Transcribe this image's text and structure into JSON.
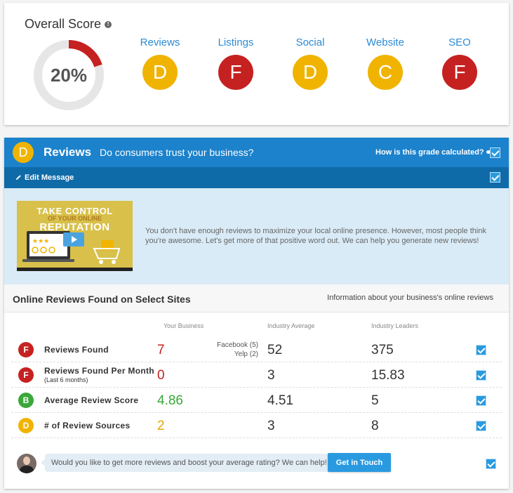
{
  "overall": {
    "title": "Overall Score",
    "score_label": "20%",
    "score_fraction": 0.2,
    "colors": {
      "arc": "#c62121",
      "track": "#e6e6e6"
    }
  },
  "categories": [
    {
      "label": "Reviews",
      "grade": "D"
    },
    {
      "label": "Listings",
      "grade": "F"
    },
    {
      "label": "Social",
      "grade": "D"
    },
    {
      "label": "Website",
      "grade": "C"
    },
    {
      "label": "SEO",
      "grade": "F"
    }
  ],
  "reviews_section": {
    "grade": "D",
    "title": "Reviews",
    "subtitle": "Do consumers trust your business?",
    "how_label": "How is this grade calculated?",
    "edit_label": "Edit Message",
    "promo": {
      "line1": "TAKE CONTROL",
      "line2": "OF YOUR ONLINE",
      "line3": "REPUTATION"
    },
    "message": "You don't have enough reviews to maximize your local online presence. However, most people think you're awesome. Let's get more of that positive word out. We can help you generate new reviews!"
  },
  "table": {
    "title": "Online Reviews Found on Select Sites",
    "subtitle": "Information about your business's online reviews",
    "columns": [
      "Your Business",
      "Industry Average",
      "Industry Leaders"
    ],
    "rows": [
      {
        "grade": "F",
        "label": "Reviews Found",
        "sublabel": "",
        "yours": "7",
        "extra1": "Facebook (5)",
        "extra2": "Yelp (2)",
        "industry": "52",
        "leaders": "375"
      },
      {
        "grade": "F",
        "label": "Reviews Found Per Month",
        "sublabel": "(Last 6 months)",
        "yours": "0",
        "extra1": "",
        "extra2": "",
        "industry": "3",
        "leaders": "15.83"
      },
      {
        "grade": "B",
        "label": "Average Review Score",
        "sublabel": "",
        "yours": "4.86",
        "extra1": "",
        "extra2": "",
        "industry": "4.51",
        "leaders": "5"
      },
      {
        "grade": "D",
        "label": "# of Review Sources",
        "sublabel": "",
        "yours": "2",
        "extra1": "",
        "extra2": "",
        "industry": "3",
        "leaders": "8"
      }
    ]
  },
  "cta": {
    "message": "Would you like to get more reviews and boost your average rating? We can help!",
    "button": "Get in Touch"
  },
  "icons": [
    "info-icon",
    "pencil-icon",
    "checkbox-icon",
    "avatar",
    "play-icon",
    "cart-icon",
    "laptop-icon"
  ],
  "theme": {
    "primary": "#1c82cc",
    "primary_dark": "#0f6aa8",
    "link": "#2a8bd4",
    "grade_D": "#f0b400",
    "grade_F": "#c62121",
    "grade_B": "#3aa83a"
  }
}
